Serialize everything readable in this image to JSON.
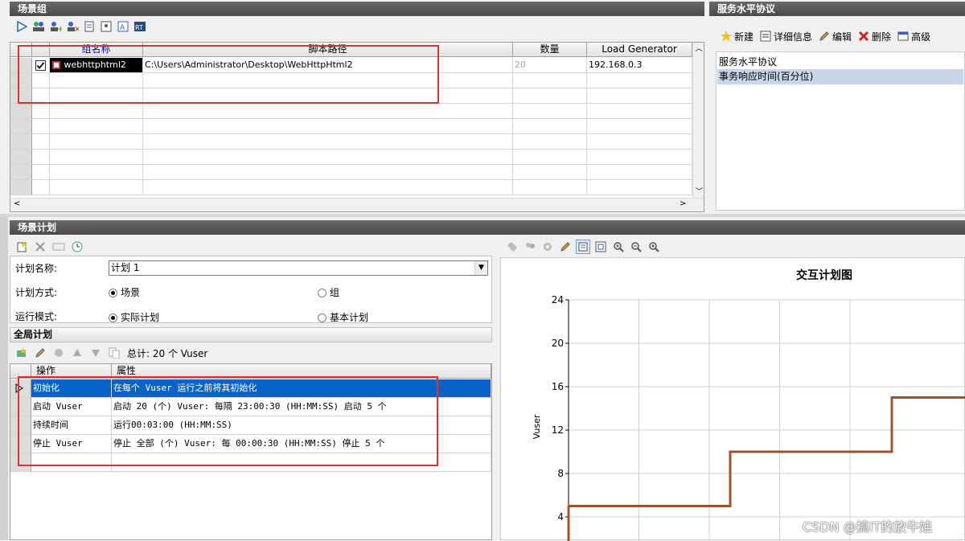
{
  "scenario_group": {
    "title": "场景组",
    "columns": [
      "组名称",
      "脚本路径",
      "数量",
      "Load Generator"
    ],
    "rows": [
      {
        "checked": true,
        "name": "webhttphtml2",
        "path": "C:\\Users\\Administrator\\Desktop\\WebHttpHtml2",
        "quantity": "20",
        "load_generator": "192.168.0.3"
      }
    ]
  },
  "sla": {
    "title": "服务水平协议",
    "toolbar": {
      "new": "新建",
      "details": "详细信息",
      "edit": "编辑",
      "delete": "删除",
      "advanced": "高级"
    },
    "items": [
      "服务水平协议",
      "事务响应时间(百分位)"
    ]
  },
  "schedule": {
    "title": "场景计划",
    "plan_name_label": "计划名称:",
    "plan_name_value": "计划 1",
    "plan_mode_label": "计划方式:",
    "plan_mode_options": [
      "场景",
      "组"
    ],
    "run_mode_label": "运行模式:",
    "run_mode_options": [
      "实际计划",
      "基本计划"
    ]
  },
  "global_schedule": {
    "title": "全局计划",
    "total": "总计: 20 个 Vuser",
    "columns": [
      "操作",
      "属性"
    ],
    "rows": [
      {
        "action": "初始化",
        "property": "在每个 Vuser 运行之前将其初始化"
      },
      {
        "action": "启动 Vuser",
        "property": "启动 20 (个) Vuser: 每隔 23:00:30 (HH:MM:SS) 启动 5 个"
      },
      {
        "action": "持续时间",
        "property": "运行00:03:00 (HH:MM:SS)"
      },
      {
        "action": "停止 Vuser",
        "property": "停止 全部 (个) Vuser: 每 00:00:30 (HH:MM:SS) 停止 5 个"
      }
    ]
  },
  "chart_data": {
    "type": "line",
    "title": "交互计划图",
    "ylabel": "Vuser",
    "xlabel": "",
    "ylim": [
      0,
      24
    ],
    "yticks": [
      4,
      8,
      12,
      16,
      20,
      24
    ],
    "series": [
      {
        "color": "#a0522d",
        "points": [
          [
            0,
            5
          ],
          [
            1.5,
            5
          ],
          [
            1.5,
            10
          ],
          [
            3,
            10
          ],
          [
            3,
            15
          ],
          [
            4,
            15
          ]
        ]
      }
    ]
  },
  "watermark": "CSDN @搞IT的放牛娃"
}
